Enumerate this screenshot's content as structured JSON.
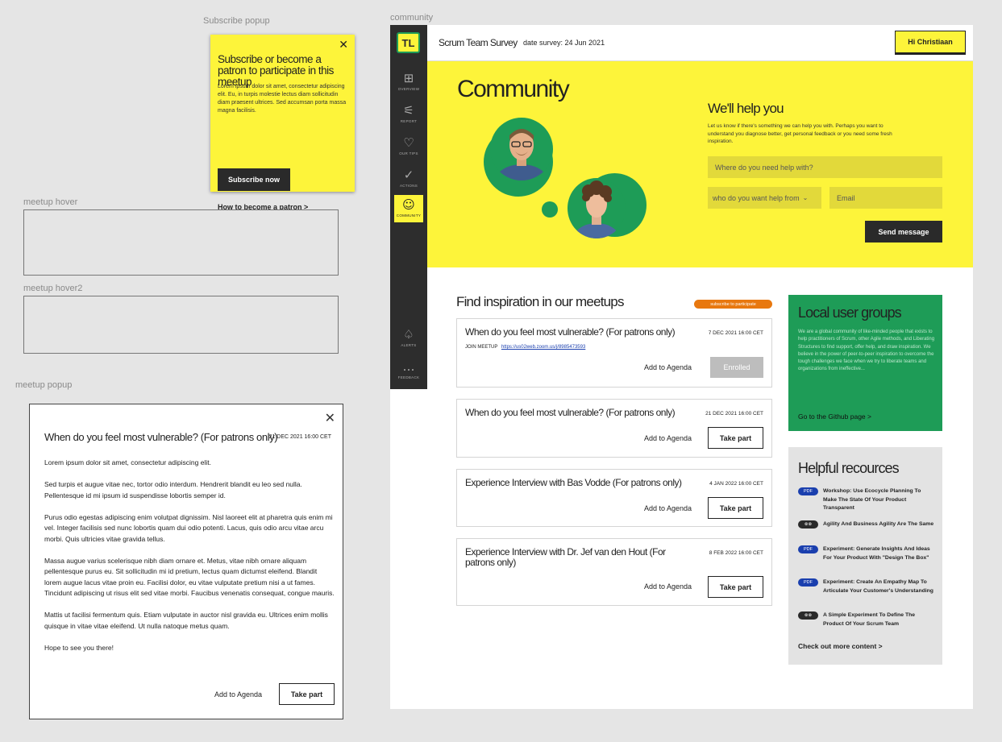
{
  "canvas_labels": {
    "subscribe_popup": "Subscribe popup",
    "community": "community",
    "meetup_hover": "meetup hover",
    "meetup_hover2": "meetup hover2",
    "meetup_popup": "meetup popup"
  },
  "subscribe_popup": {
    "close": "✕",
    "title": "Subscribe or become a patron to participate in this meetup",
    "body": "Lorem ipsum dolor sit amet, consectetur adipiscing elit. Eu, in turpis molestie lectus diam sollicitudin diam praesent ultrices. Sed accumsan porta massa magna facilisis.",
    "button": "Subscribe now",
    "link": "How to become a patron >"
  },
  "meetup_popup": {
    "close": "✕",
    "title": "When do you feel most vulnerable? (For patrons only)",
    "date": "21 DEC 2021 16:00 CET",
    "paragraphs": [
      "Lorem ipsum dolor sit amet, consectetur adipiscing elit.",
      "Sed turpis et augue vitae nec, tortor odio interdum. Hendrerit blandit eu leo sed nulla. Pellentesque id mi ipsum id suspendisse lobortis semper id.",
      "Purus odio egestas adipiscing enim volutpat dignissim. Nisl laoreet elit at pharetra quis enim mi vel. Integer facilisis sed nunc lobortis quam dui odio potenti. Lacus, quis odio arcu vitae arcu morbi. Quis ultricies vitae gravida tellus.",
      " Massa augue varius scelerisque nibh diam ornare et. Metus, vitae nibh ornare aliquam pellentesque purus eu. Sit sollicitudin mi id pretium, lectus quam dictumst eleifend. Blandit lorem augue lacus vitae proin eu. Facilisi dolor, eu vitae vulputate pretium nisi a ut fames. Tincidunt adipiscing ut risus elit sed vitae morbi. Faucibus venenatis consequat, congue mauris.",
      "Mattis ut facilisi fermentum quis. Etiam vulputate in auctor nisl gravida eu. Ultrices enim mollis quisque in vitae vitae eleifend. Ut nulla natoque metus quam.",
      "Hope to see you there!"
    ],
    "add_to_agenda": "Add to Agenda",
    "take_part": "Take part"
  },
  "app": {
    "logo": "TL",
    "nav": [
      {
        "label": "OVERVIEW",
        "icon": "overview-icon",
        "glyph": "⊞"
      },
      {
        "label": "REPORT",
        "icon": "report-icon",
        "glyph": "⚟"
      },
      {
        "label": "OUR TIPS",
        "icon": "lightbulb-icon",
        "glyph": "♡"
      },
      {
        "label": "ACTIONS",
        "icon": "check-circle-icon",
        "glyph": "✓"
      },
      {
        "label": "COMMUNITY",
        "icon": "community-icon",
        "glyph": "☺"
      },
      {
        "label": "ALERTS",
        "icon": "bell-icon",
        "glyph": "♤"
      },
      {
        "label": "FEEDBACK",
        "icon": "chat-icon",
        "glyph": "…"
      }
    ],
    "title": "Scrum Team Survey",
    "survey_date": "date survey: 24 Jun 2021",
    "user_button": "Hi Christiaan"
  },
  "hero": {
    "heading": "Community",
    "help_heading": "We'll help you",
    "help_text": "Let us know if there's something we can help you with. Perhaps you want to understand you diagnose better, get personal feedback or you need some fresh inspiration.",
    "help_placeholder": "Where do you need help with?",
    "who_select": "who do you want help from",
    "email_placeholder": "Email",
    "send": "Send message"
  },
  "meetups": {
    "heading": "Find inspiration in our meetups",
    "badge": "subscribe to participate",
    "cards": [
      {
        "title": "When do you feel most vulnerable? (For patrons only)",
        "date": "7 DEC 2021 16:00 CET",
        "join_label": "JOIN MEETUP",
        "join_url": "https://us02web.zoom.us/j/8985473593",
        "agenda": "Add to Agenda",
        "action": "Enrolled"
      },
      {
        "title": "When do you feel most vulnerable? (For patrons only)",
        "date": "21 DEC 2021 16:00 CET",
        "agenda": "Add to Agenda",
        "action": "Take part"
      },
      {
        "title": "Experience Interview with Bas Vodde  (For patrons only)",
        "date": "4 JAN 2022 16:00 CET",
        "agenda": "Add to Agenda",
        "action": "Take part"
      },
      {
        "title": "Experience Interview with Dr. Jef van den Hout (For patrons only)",
        "date": "8 FEB 2022 16:00 CET",
        "agenda": "Add to Agenda",
        "action": "Take part"
      }
    ]
  },
  "groups": {
    "heading": "Local user groups",
    "text": "We are a global community of like-minded people that exists to help practitioners of Scrum, other Agile methods, and Liberating Structures to find support, offer help, and draw inspiration. We believe in the power of peer-to-peer inspiration to overcome the tough challenges we face when we try to liberate teams and organizations from ineffective...",
    "link": "Go to the Github page >"
  },
  "resources": {
    "heading": "Helpful recources",
    "items": [
      {
        "tag": "PDF",
        "kind": "pdf",
        "text": "Workshop: Use Ecocycle Planning To Make The State Of Your Product Transparent"
      },
      {
        "tag": "⊗⊗",
        "kind": "link",
        "text": "Agility And Business Agility Are The Same"
      },
      {
        "tag": "PDF",
        "kind": "pdf",
        "text": "Experiment: Generate Insights And Ideas For Your Product With \"Design The Box\""
      },
      {
        "tag": "PDF",
        "kind": "pdf",
        "text": "Experiment: Create An Empathy Map To Articulate Your Customer's Understanding"
      },
      {
        "tag": "⊗⊗",
        "kind": "link",
        "text": "A Simple Experiment To Define The Product Of Your Scrum Team"
      }
    ],
    "more": "Check out more content >"
  }
}
